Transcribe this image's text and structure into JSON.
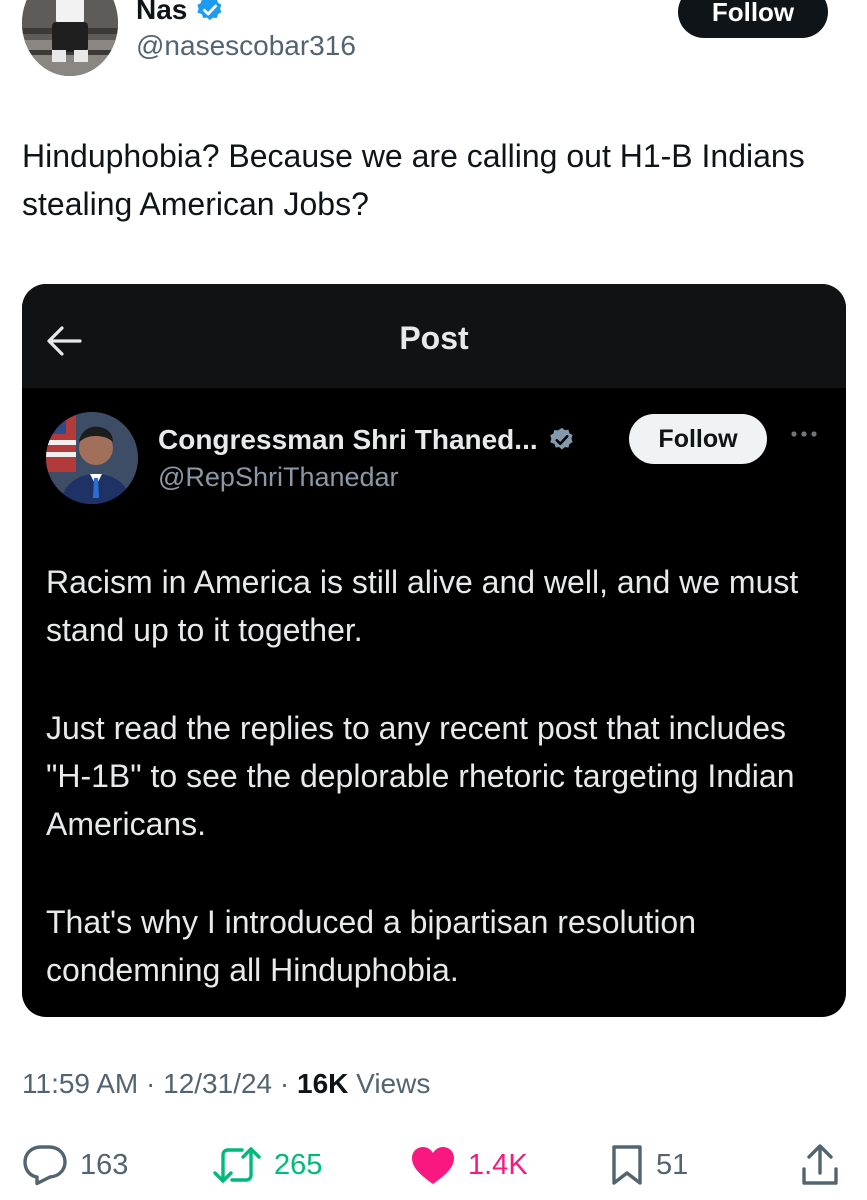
{
  "author": {
    "name": "Nas",
    "handle": "@nasescobar316",
    "follow_label": "Follow",
    "verified": true
  },
  "tweet": {
    "text": "Hinduphobia? Because we are calling out H1-B Indians stealing American Jobs?"
  },
  "quoted_post": {
    "screen_title": "Post",
    "author_name": "Congressman Shri Thaned...",
    "author_handle": "@RepShriThanedar",
    "follow_label": "Follow",
    "paragraphs": [
      "Racism in America is still alive and well, and we must stand up to it together.",
      "Just read the replies to any recent post that includes \"H-1B\" to see the deplorable rhetoric targeting Indian Americans.",
      "That's why I introduced a bipartisan resolution condemning all Hinduphobia."
    ]
  },
  "meta": {
    "time": "11:59 AM",
    "separator": " · ",
    "date": "12/31/24",
    "views_count": "16K",
    "views_label": " Views"
  },
  "actions": {
    "replies": "163",
    "reposts": "265",
    "likes": "1.4K",
    "bookmarks": "51"
  },
  "colors": {
    "verified": "#1d9bf0",
    "repost": "#00ba7c",
    "like": "#f91880",
    "muted": "#536471",
    "card_bg": "#000000"
  },
  "icons": [
    "verified-badge-icon",
    "back-arrow-icon",
    "more-icon",
    "reply-icon",
    "repost-icon",
    "like-icon",
    "bookmark-icon",
    "share-icon"
  ]
}
